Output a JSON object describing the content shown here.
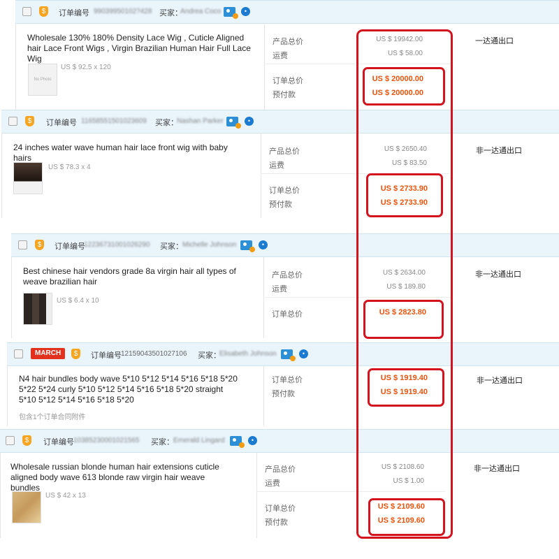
{
  "labels": {
    "order_no": "订单编号",
    "buyer": "买家：",
    "product_total": "产品总价",
    "shipping": "运费",
    "order_total": "订单总价",
    "prepaid": "预付款"
  },
  "orders": [
    {
      "order_number": "99039950102?428",
      "buyer": "Andrea Coco",
      "title": "Wholesale 130% 180% Density Lace Wig , Cuticle Aligned hair Lace Front Wigs , Virgin Brazilian Human Hair Full Lace Wig",
      "thumb_label": "No Photo",
      "unit_price": "US $ 92.5 x 120",
      "product_total": "US $ 19942.00",
      "shipping": "US $ 58.00",
      "order_total": "US $ 20000.00",
      "prepaid": "US $ 20000.00",
      "status": "一达通出口"
    },
    {
      "order_number": "11658551501023609",
      "buyer": "Nashan Parker",
      "title": "24 inches water wave human hair lace front wig with baby hairs",
      "unit_price": "US $ 78.3 x 4",
      "product_total": "US $ 2650.40",
      "shipping": "US $ 83.50",
      "order_total": "US $ 2733.90",
      "prepaid": "US $ 2733.90",
      "status": "非一达通出口"
    },
    {
      "order_number": "12236731001026290",
      "buyer": "Michelle Johnson",
      "title": "Best chinese hair vendors grade 8a virgin hair all types of weave brazilian hair",
      "unit_price": "US $ 6.4 x 10",
      "product_total": "US $ 2634.00",
      "shipping": "US $ 189.80",
      "order_total": "US $ 2823.80",
      "status": "非一达通出口"
    },
    {
      "badge": "MARCH",
      "order_number": "12159043501027106",
      "buyer": "Elisabeth Johnson",
      "title": "N4 hair bundles body wave 5*10 5*12 5*14 5*16 5*18 5*20 5*22 5*24 curly 5*10 5*12 5*14 5*16 5*18 5*20 straight 5*10 5*12 5*14 5*16 5*18 5*20",
      "note": "包含1个订单合同附件",
      "order_total": "US $ 1919.40",
      "prepaid": "US $ 1919.40",
      "status": "非一达通出口"
    },
    {
      "order_number": "10385230001021565",
      "buyer": "Emerald Lingard",
      "title": "Wholesale russian blonde human hair extensions cuticle aligned body wave 613 blonde raw virgin hair weave bundles",
      "unit_price": "US $ 42 x 13",
      "product_total": "US $ 2108.60",
      "shipping": "US $ 1.00",
      "order_total": "US $ 2109.60",
      "prepaid": "US $ 2109.60",
      "status": "非一达通出口"
    }
  ],
  "colors": {
    "highlight_border": "#d3141f",
    "price_red": "#e8530e",
    "header_bg": "#e9f4fb"
  }
}
